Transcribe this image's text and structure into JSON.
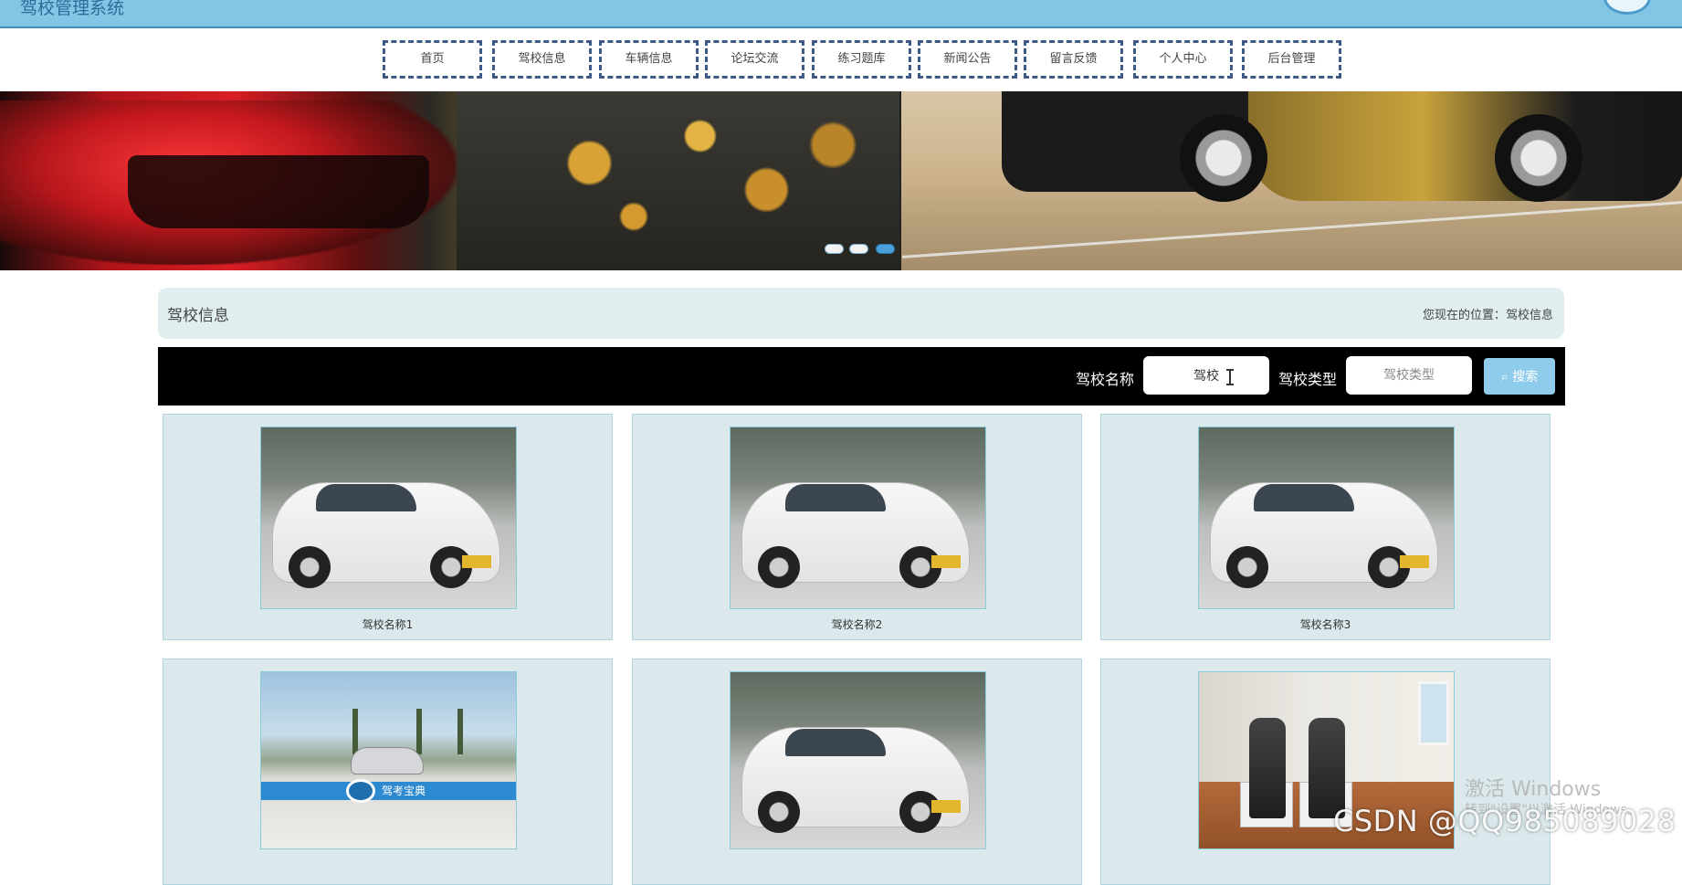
{
  "app": {
    "title": "驾校管理系统"
  },
  "nav": {
    "items": [
      {
        "label": "首页"
      },
      {
        "label": "驾校信息"
      },
      {
        "label": "车辆信息"
      },
      {
        "label": "论坛交流"
      },
      {
        "label": "练习题库"
      },
      {
        "label": "新闻公告"
      },
      {
        "label": "留言反馈"
      },
      {
        "label": "个人中心"
      },
      {
        "label": "后台管理"
      }
    ]
  },
  "banner": {
    "slide_count": 3,
    "active_slide": 3
  },
  "section": {
    "title": "驾校信息",
    "breadcrumb": "您现在的位置：驾校信息"
  },
  "search": {
    "name_label": "驾校名称",
    "name_value": "驾校",
    "type_label": "驾校类型",
    "type_placeholder": "驾校类型",
    "button_label": "搜索"
  },
  "cards": [
    {
      "name": "驾校名称1"
    },
    {
      "name": "驾校名称2"
    },
    {
      "name": "驾校名称3"
    },
    {
      "name": "",
      "image_caption": "驾考宝典"
    },
    {
      "name": ""
    },
    {
      "name": ""
    }
  ],
  "overlay": {
    "activate_line1": "激活 Windows",
    "activate_line2": "转到\"设置\"以激活 Windows。",
    "watermark": "CSDN @QQ985089028"
  },
  "colors": {
    "topbar": "#82c5e4",
    "nav_border": "#3d5a86",
    "section_bg": "#e1eef0",
    "searchbar_bg": "#000000",
    "search_button": "#8fcbea",
    "card_bg": "#dce9ec"
  }
}
